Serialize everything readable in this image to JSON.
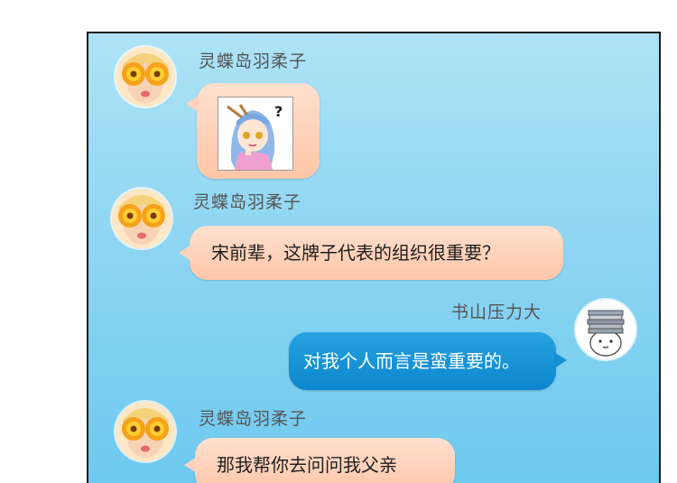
{
  "messages": [
    {
      "sender": "灵蝶岛羽柔子",
      "side": "left",
      "type": "sticker",
      "sticker_text": "?"
    },
    {
      "sender": "灵蝶岛羽柔子",
      "side": "left",
      "type": "text",
      "text": "宋前辈，这牌子代表的组织很重要？"
    },
    {
      "sender": "书山压力大",
      "side": "right",
      "type": "text",
      "text": "对我个人而言是蛮重要的。"
    },
    {
      "sender": "灵蝶岛羽柔子",
      "side": "left",
      "type": "text",
      "text": "那我帮你去问问我父亲"
    }
  ],
  "colors": {
    "panel_top": "#aee3f6",
    "panel_bottom": "#6ec9ef",
    "left_bubble": "#ffc6a8",
    "right_bubble": "#0b86cc"
  }
}
